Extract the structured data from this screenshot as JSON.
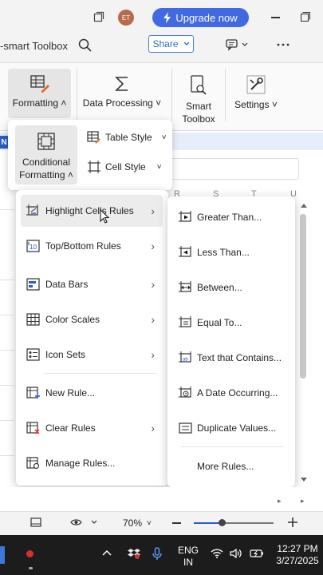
{
  "titlebar": {
    "avatar_initials": "ET",
    "upgrade_label": "Upgrade now"
  },
  "toolbar": {
    "app_name": "-smart Toolbox",
    "share_label": "Share"
  },
  "ribbon": {
    "formatting_label": "Formatting",
    "data_processing_label": "Data Processing",
    "smart_toolbox_line1": "Smart",
    "smart_toolbox_line2": "Toolbox",
    "settings_label": "Settings"
  },
  "formatting_popup": {
    "conditional_line1": "Conditional",
    "conditional_line2": "Formatting",
    "table_style_label": "Table Style",
    "cell_style_label": "Cell Style"
  },
  "sheet": {
    "active_cell_letter": "N",
    "columns": [
      "R",
      "S",
      "T",
      "U"
    ]
  },
  "menu": {
    "items": [
      {
        "label": "Highlight Cells Rules",
        "icon": "highlight-rules-icon"
      },
      {
        "label": "Top/Bottom Rules",
        "icon": "top-bottom-icon"
      },
      {
        "label": "Data Bars",
        "icon": "data-bars-icon"
      },
      {
        "label": "Color Scales",
        "icon": "color-scales-icon"
      },
      {
        "label": "Icon Sets",
        "icon": "icon-sets-icon"
      },
      {
        "label": "New Rule...",
        "icon": "new-rule-icon"
      },
      {
        "label": "Clear Rules",
        "icon": "clear-rules-icon"
      },
      {
        "label": "Manage Rules...",
        "icon": "manage-rules-icon"
      }
    ]
  },
  "submenu": {
    "items": [
      {
        "label": "Greater Than...",
        "icon": "greater-than-icon"
      },
      {
        "label": "Less Than...",
        "icon": "less-than-icon"
      },
      {
        "label": "Between...",
        "icon": "between-icon"
      },
      {
        "label": "Equal To...",
        "icon": "equal-to-icon"
      },
      {
        "label": "Text that Contains...",
        "icon": "text-contains-icon"
      },
      {
        "label": "A Date Occurring...",
        "icon": "date-occurring-icon"
      },
      {
        "label": "Duplicate Values...",
        "icon": "duplicate-values-icon"
      },
      {
        "label": "More Rules...",
        "icon": ""
      }
    ]
  },
  "statusbar": {
    "zoom": "70%",
    "zoom_fraction": 0.35
  },
  "taskbar": {
    "lang_line1": "ENG",
    "lang_line2": "IN",
    "time": "12:27 PM",
    "date": "3/27/2025"
  },
  "colors": {
    "accent": "#2b5dc6",
    "upgrade": "#4169e1",
    "selection": "#ececec"
  }
}
